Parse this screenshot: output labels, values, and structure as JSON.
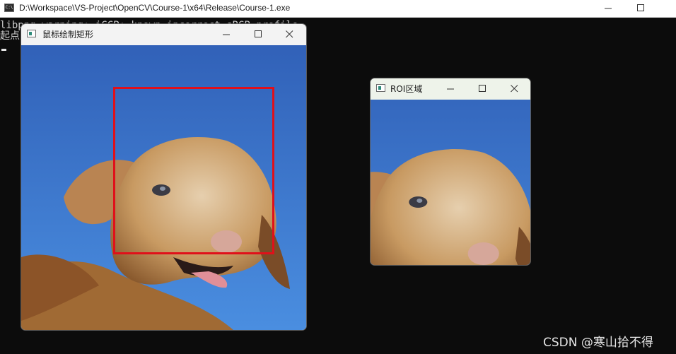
{
  "console": {
    "title": "D:\\Workspace\\VS-Project\\OpenCV\\Course-1\\x64\\Release\\Course-1.exe",
    "icon_text": "C:\\",
    "lines": [
      "libpng warning: iCCP: known incorrect sRGB profile",
      "起点"
    ]
  },
  "main_window": {
    "title": "鼠标绘制矩形"
  },
  "roi_window": {
    "title": "ROI区域"
  },
  "watermark": "CSDN @寒山拾不得",
  "colors": {
    "selection_rect": "#e0101a",
    "sky_top": "#3161b8",
    "sky_bottom": "#4a8ee0",
    "wool": "#c89a62"
  },
  "icons": [
    "minimize-icon",
    "maximize-icon",
    "close-icon",
    "window-app-icon"
  ]
}
